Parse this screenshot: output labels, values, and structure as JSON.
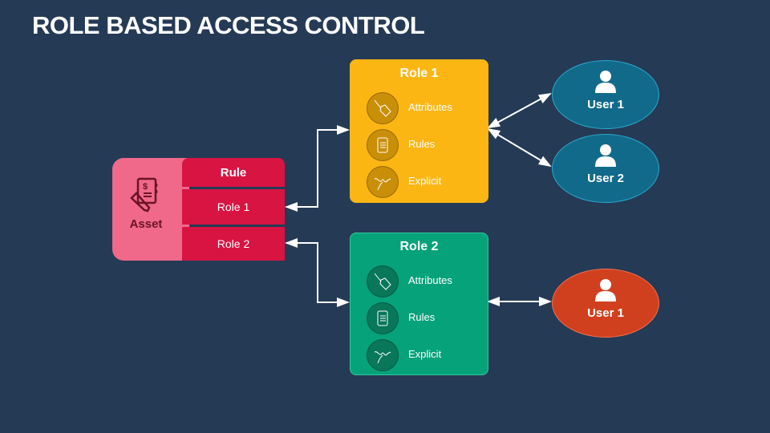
{
  "title": "ROLE BASED ACCESS CONTROL",
  "asset": {
    "label": "Asset",
    "icon": "document-pen-icon"
  },
  "rule_table": {
    "header": "Rule",
    "rows": [
      "Role 1",
      "Role 2"
    ]
  },
  "roles": [
    {
      "title": "Role 1",
      "color": "#fcb614",
      "items": [
        {
          "label": "Attributes",
          "icon": "tag-icon"
        },
        {
          "label": "Rules",
          "icon": "scroll-icon"
        },
        {
          "label": "Explicit",
          "icon": "signature-icon"
        }
      ]
    },
    {
      "title": "Role 2",
      "color": "#06a27a",
      "items": [
        {
          "label": "Attributes",
          "icon": "tag-icon"
        },
        {
          "label": "Rules",
          "icon": "scroll-icon"
        },
        {
          "label": "Explicit",
          "icon": "signature-icon"
        }
      ]
    }
  ],
  "users": [
    {
      "label": "User 1",
      "role": "Role 1",
      "color": "#126a8a"
    },
    {
      "label": "User 2",
      "role": "Role 1",
      "color": "#126a8a"
    },
    {
      "label": "User 1",
      "role": "Role 2",
      "color": "#d0401e"
    }
  ]
}
